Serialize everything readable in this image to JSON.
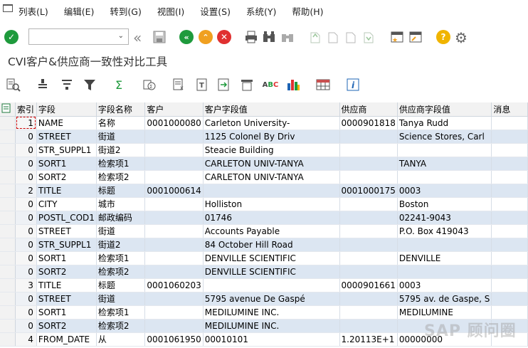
{
  "menu": [
    "列表(L)",
    "编辑(E)",
    "转到(G)",
    "视图(I)",
    "设置(S)",
    "系统(Y)",
    "帮助(H)"
  ],
  "command_field": {
    "value": ""
  },
  "title": "CVI客户&供应商一致性对比工具",
  "colors": {
    "row_alt": "#dce6f2",
    "header_bg": "#f2f2f2",
    "ok_green": "#1e9a3c",
    "nav_orange": "#f0a020",
    "cancel_red": "#e03030",
    "help_yellow": "#f0b400"
  },
  "table": {
    "columns": [
      "索引",
      "字段",
      "字段名称",
      "客户",
      "客户字段值",
      "供应商",
      "供应商字段值",
      "消息"
    ],
    "rows": [
      [
        "1",
        "NAME",
        "名称",
        "0001000080",
        "Carleton University-",
        "0000901818",
        "Tanya Rudd",
        ""
      ],
      [
        "0",
        "STREET",
        "街道",
        "",
        "1125 Colonel By Driv",
        "",
        "Science Stores, Carl",
        ""
      ],
      [
        "0",
        "STR_SUPPL1",
        "街道2",
        "",
        "Steacie Building",
        "",
        "",
        ""
      ],
      [
        "0",
        "SORT1",
        "检索项1",
        "",
        "CARLETON UNIV-TANYA",
        "",
        "TANYA",
        ""
      ],
      [
        "0",
        "SORT2",
        "检索项2",
        "",
        "CARLETON UNIV-TANYA",
        "",
        "",
        ""
      ],
      [
        "2",
        "TITLE",
        "标题",
        "0001000614",
        "",
        "0001000175",
        "0003",
        ""
      ],
      [
        "0",
        "CITY",
        "城市",
        "",
        "Holliston",
        "",
        "Boston",
        ""
      ],
      [
        "0",
        "POSTL_COD1",
        "邮政编码",
        "",
        "01746",
        "",
        "02241-9043",
        ""
      ],
      [
        "0",
        "STREET",
        "街道",
        "",
        "Accounts Payable",
        "",
        "P.O. Box 419043",
        ""
      ],
      [
        "0",
        "STR_SUPPL1",
        "街道2",
        "",
        "84 October Hill Road",
        "",
        "",
        ""
      ],
      [
        "0",
        "SORT1",
        "检索项1",
        "",
        "DENVILLE SCIENTIFIC",
        "",
        "DENVILLE",
        ""
      ],
      [
        "0",
        "SORT2",
        "检索项2",
        "",
        "DENVILLE SCIENTIFIC",
        "",
        "",
        ""
      ],
      [
        "3",
        "TITLE",
        "标题",
        "0001060203",
        "",
        "0000901661",
        "0003",
        ""
      ],
      [
        "0",
        "STREET",
        "街道",
        "",
        "5795 avenue De Gaspé",
        "",
        "5795 av. de Gaspe, S",
        ""
      ],
      [
        "0",
        "SORT1",
        "检索项1",
        "",
        "MEDILUMINE INC.",
        "",
        "MEDILUMINE",
        ""
      ],
      [
        "0",
        "SORT2",
        "检索项2",
        "",
        "MEDILUMINE INC.",
        "",
        "",
        ""
      ],
      [
        "4",
        "FROM_DATE",
        "从",
        "0001061950",
        "00010101",
        "1.20113E+1",
        "00000000",
        ""
      ]
    ]
  },
  "watermark": "SAP 顾问圈"
}
